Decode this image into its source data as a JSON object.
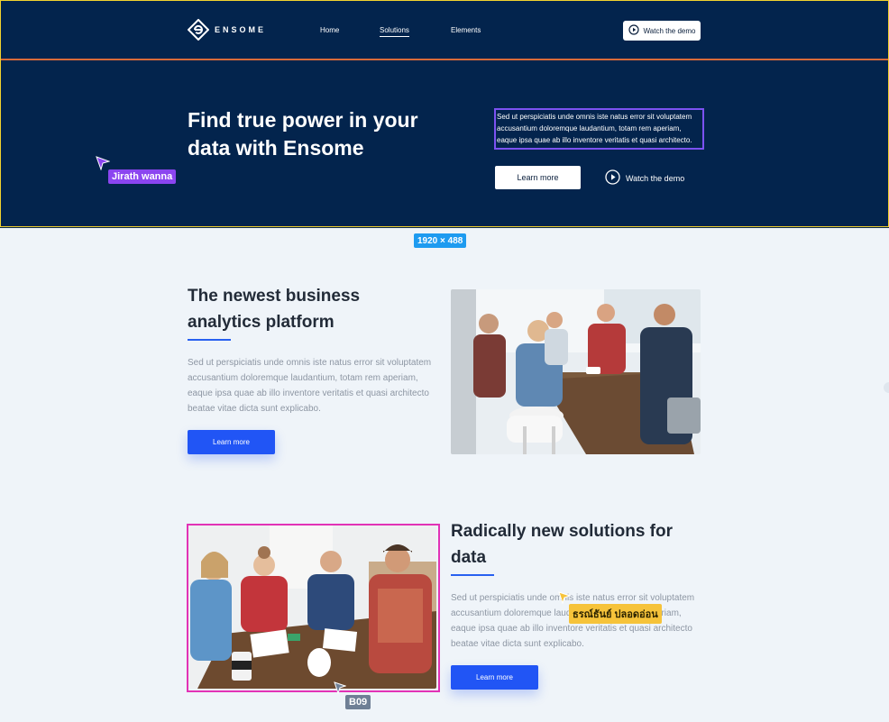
{
  "nav": {
    "logo_text": "ENSOME",
    "links": [
      "Home",
      "Solutions",
      "Elements"
    ],
    "demo_button": "Watch the demo"
  },
  "hero": {
    "title": "Find true power in your data with Ensome",
    "text": "Sed ut perspiciatis unde omnis iste natus error sit voluptatem accusantium doloremque laudantium, totam rem aperiam, eaque ipsa quae ab illo inventore veritatis et quasi architecto.",
    "learn_more": "Learn more",
    "watch_demo": "Watch the demo"
  },
  "collaborators": {
    "cursor1_name": "Jirath wanna",
    "cursor2_name": "ธรณ์ธันย์ ปลอดอ่อน",
    "cursor3_name": "B09",
    "dimension_label": "1920 × 488"
  },
  "section1": {
    "title": "The newest business analytics platform",
    "text": "Sed ut perspiciatis unde omnis iste natus error sit voluptatem accusantium doloremque laudantium, totam rem aperiam, eaque ipsa quae ab illo inventore veritatis et quasi architecto beatae vitae dicta sunt explicabo.",
    "button": "Learn more"
  },
  "section2": {
    "title": "Radically new solutions for data",
    "text": "Sed ut perspiciatis unde omnis iste natus error sit voluptatem accusantium doloremque laudantium, totam rem aperiam, eaque ipsa quae ab illo inventore veritatis et quasi architecto beatae vitae dicta sunt explicabo.",
    "button": "Learn more"
  },
  "colors": {
    "hero_bg": "#03244d",
    "accent_blue": "#2155f5",
    "cursor1": "#8b45f0",
    "cursor2": "#f6c33a",
    "cursor3": "#6f7f95",
    "selection_pink": "#e232b6",
    "frame_yellow": "#f2d22e",
    "divider_orange": "#d96b3a"
  },
  "icons": {
    "logo": "ensome-logo-icon",
    "play": "play-circle-icon",
    "cursor": "cursor-arrow-icon"
  }
}
